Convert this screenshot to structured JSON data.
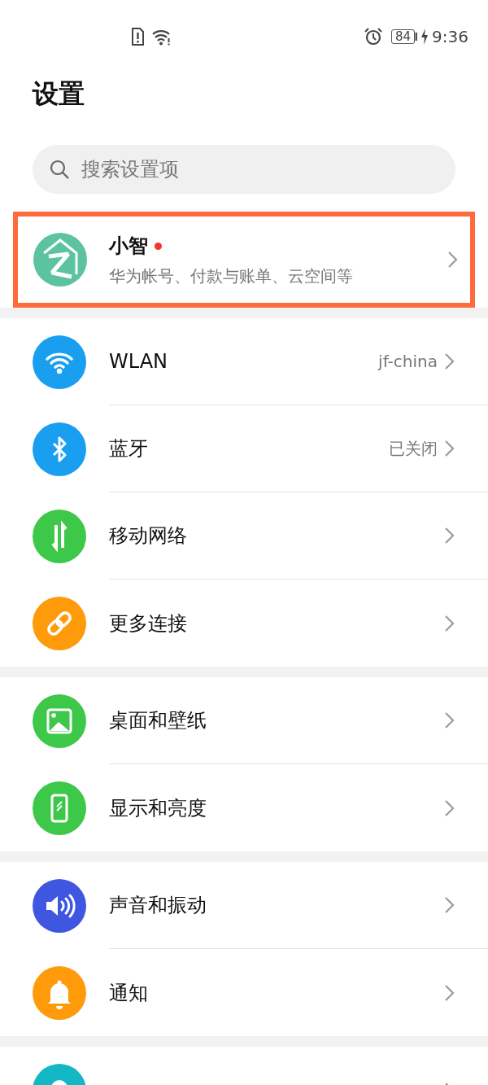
{
  "status_bar": {
    "battery": "84",
    "time": "9:36",
    "charging": true
  },
  "title": "设置",
  "search": {
    "placeholder": "搜索设置项"
  },
  "account": {
    "name": "小智",
    "unread": true,
    "subtitle": "华为帐号、付款与账单、云空间等",
    "highlighted": true
  },
  "sections": [
    {
      "items": [
        {
          "label": "WLAN",
          "value": "jf-china",
          "color": "#1a9ff0"
        },
        {
          "label": "蓝牙",
          "value": "已关闭",
          "color": "#1a9ff0"
        },
        {
          "label": "移动网络",
          "color": "#3ec84a"
        },
        {
          "label": "更多连接",
          "color": "#ff9a0a"
        }
      ]
    },
    {
      "items": [
        {
          "label": "桌面和壁纸",
          "color": "#3ec84a"
        },
        {
          "label": "显示和亮度",
          "color": "#3ec84a"
        }
      ]
    },
    {
      "items": [
        {
          "label": "声音和振动",
          "color": "#3f57e0"
        },
        {
          "label": "通知",
          "color": "#ff9a0a"
        }
      ]
    },
    {
      "items": [
        {
          "color": "#14b8c4"
        }
      ]
    }
  ]
}
